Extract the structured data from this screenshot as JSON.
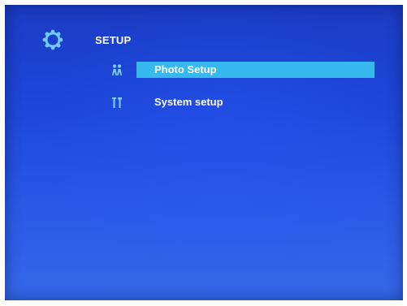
{
  "header": {
    "title": "SETUP",
    "icon": "gear-icon"
  },
  "menu": {
    "items": [
      {
        "label": "Photo Setup",
        "icon": "people-icon",
        "selected": true
      },
      {
        "label": "System setup",
        "icon": "tools-icon",
        "selected": false
      }
    ]
  },
  "colors": {
    "background": "#1e46d8",
    "highlight": "#37b9f0",
    "text": "#ffffff",
    "icon": "#7fd0ff"
  }
}
